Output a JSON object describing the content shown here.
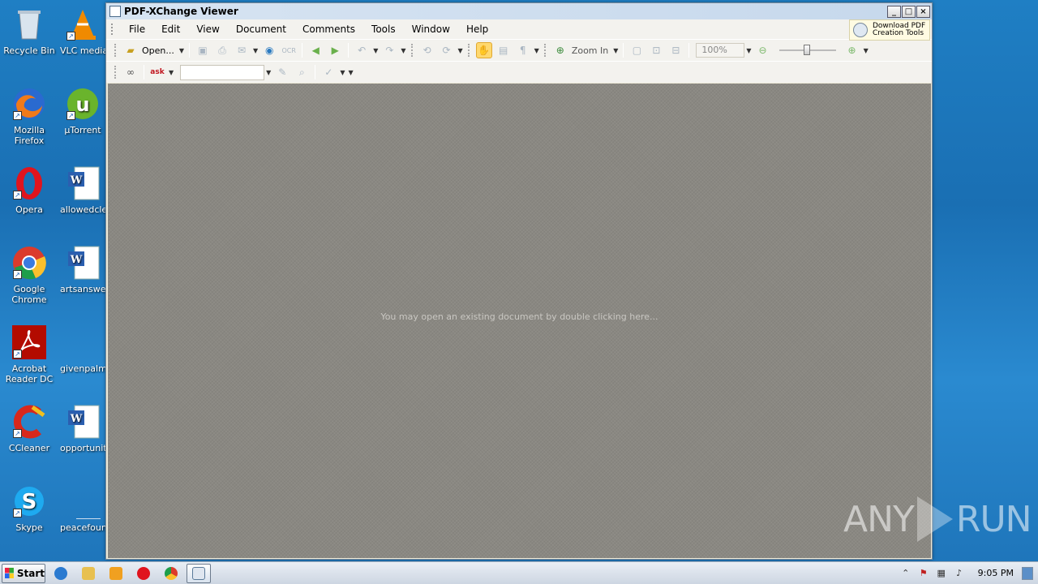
{
  "desktop": {
    "icons": [
      {
        "label": "Recycle Bin"
      },
      {
        "label": "VLC media player"
      },
      {
        "label": "Mozilla Firefox"
      },
      {
        "label": "µTorrent"
      },
      {
        "label": "Opera"
      },
      {
        "label": "allowedclea"
      },
      {
        "label": "Google Chrome"
      },
      {
        "label": "artsanswer"
      },
      {
        "label": "Acrobat Reader DC"
      },
      {
        "label": "givenpalm."
      },
      {
        "label": "CCleaner"
      },
      {
        "label": "opportunit"
      },
      {
        "label": "Skype"
      },
      {
        "label": "peacefoun"
      }
    ]
  },
  "window": {
    "title": "PDF-XChange Viewer",
    "menu": [
      "File",
      "Edit",
      "View",
      "Document",
      "Comments",
      "Tools",
      "Window",
      "Help"
    ],
    "ad": {
      "line1": "Download PDF",
      "line2": "Creation Tools"
    },
    "toolbar": {
      "open_label": "Open...",
      "ocr_label": "OCR",
      "zoom_in_label": "Zoom In",
      "zoom_value": "100%"
    },
    "hint": "You may open an existing document by double clicking here..."
  },
  "watermark": {
    "left": "ANY",
    "right": "RUN"
  },
  "taskbar": {
    "start_label": "Start",
    "clock": "9:05 PM"
  },
  "colors": {
    "desktop_blue": "#1f7fc4",
    "doc_bg": "#8a8882",
    "active_tool": "#ffd86e"
  }
}
